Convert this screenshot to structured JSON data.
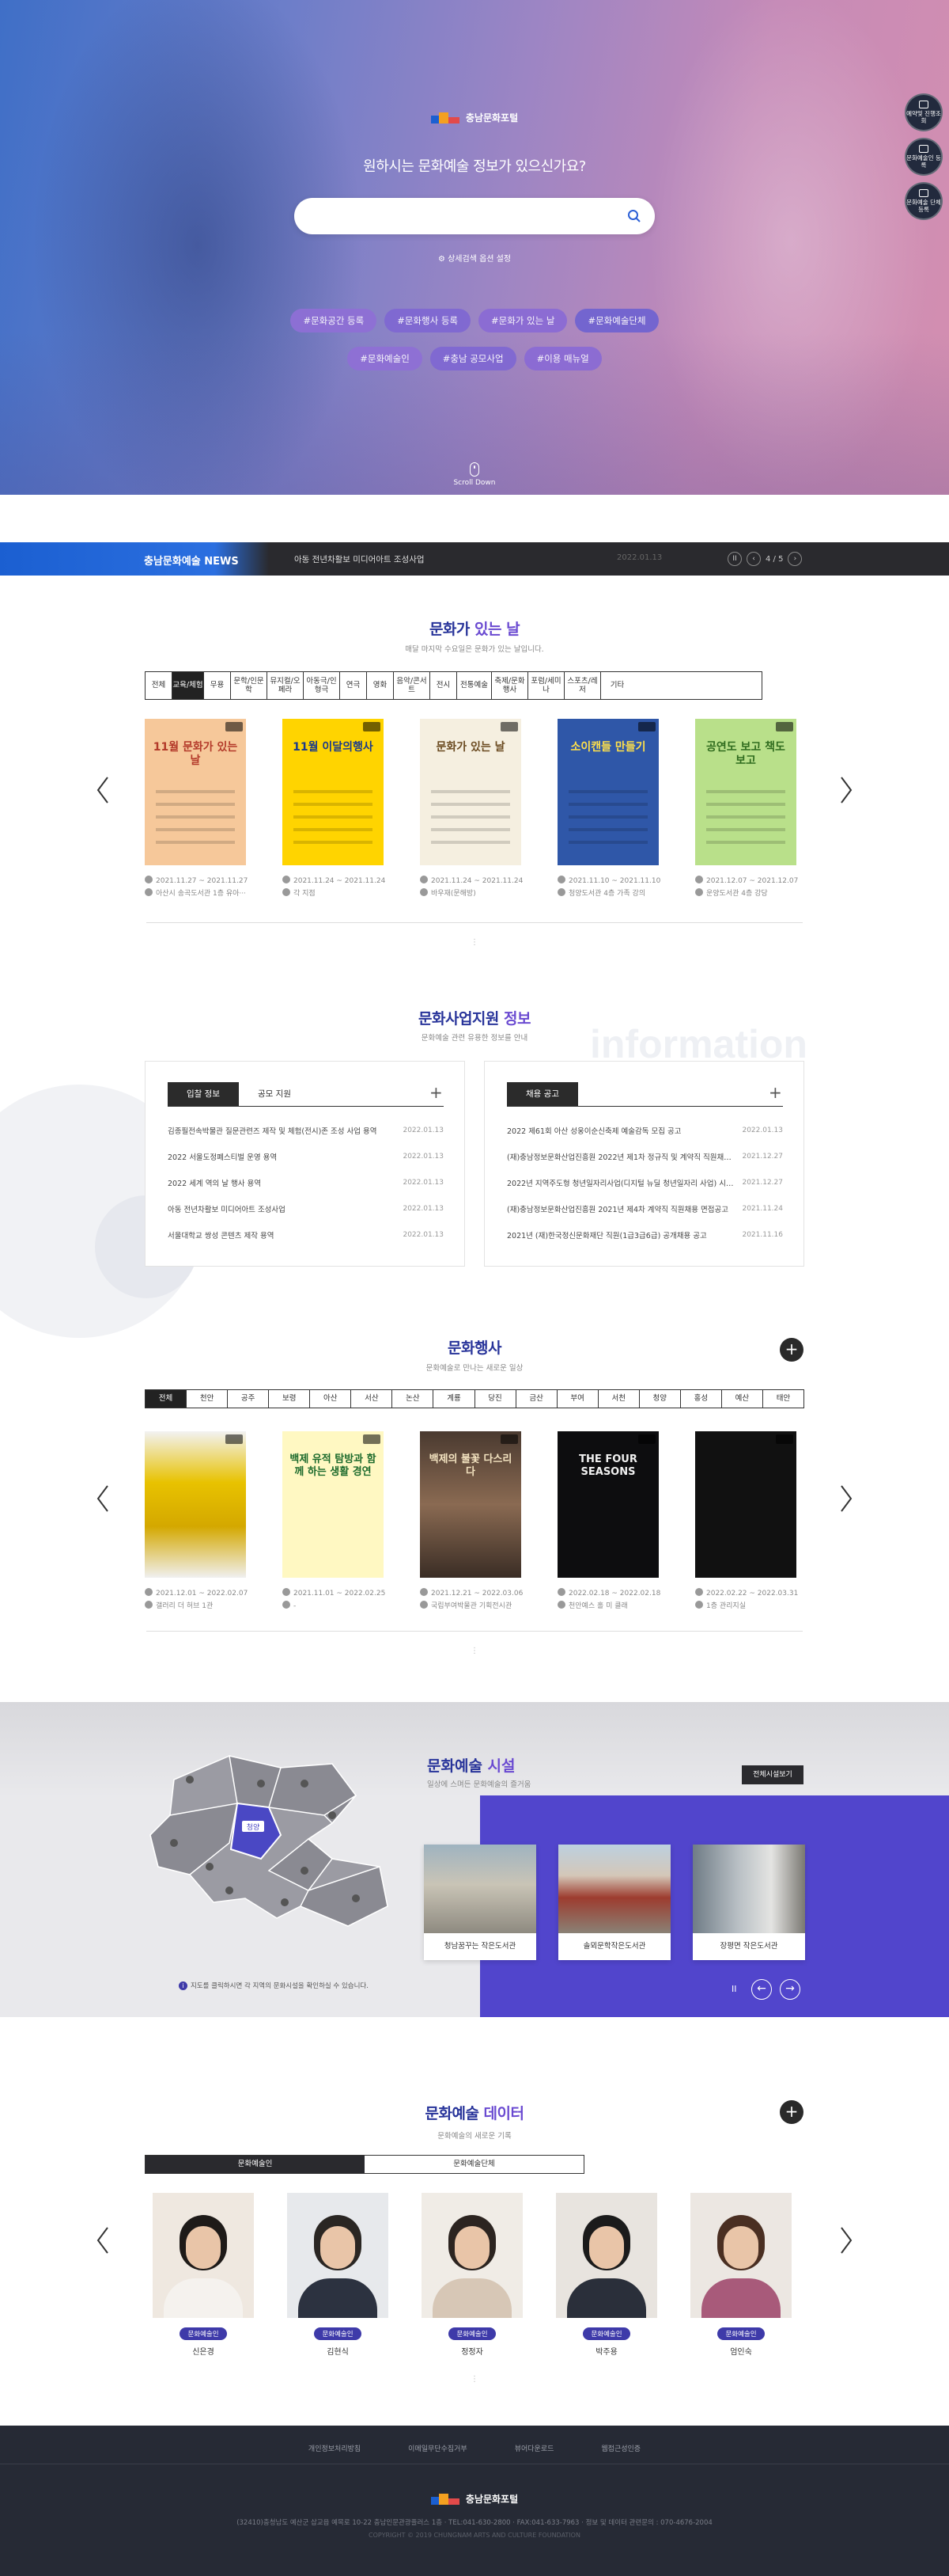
{
  "hero": {
    "logo_text": "충남문화포털",
    "title": "원하시는 문화예술 정보가 있으신가요?",
    "search_placeholder": "",
    "advanced_link": "상세검색 옵션 설정",
    "tags_row1": [
      "#문화공간 등록",
      "#문화행사 등록",
      "#문화가 있는 날",
      "#문화예술단체"
    ],
    "tags_row2": [
      "#문화예술인",
      "#충남 공모사업",
      "#이용 매뉴얼"
    ],
    "scroll_label": "Scroll Down",
    "quick_menu": [
      "예약및 진행조회",
      "문화예술인 등록",
      "문화예술 단체등록"
    ]
  },
  "news": {
    "label": "충남문화예술 NEWS",
    "headline": "아동 전년차활보 미디어아트 조성사업",
    "date": "2022.01.13",
    "pager": "4 / 5"
  },
  "culture_day": {
    "title_main": "문화가 ",
    "title_accent": "있는 날",
    "subtitle": "매달 마지막 수요일은 문화가 있는 날입니다.",
    "categories": [
      "전체",
      "교육/체험",
      "무용",
      "문학/인문학",
      "뮤지컬/오페라",
      "아동극/인형극",
      "연극",
      "영화",
      "음악/콘서트",
      "전시",
      "전통예술",
      "축제/문화행사",
      "포럼/세미나",
      "스포츠/레저",
      "기타"
    ],
    "active_category": 1,
    "cards": [
      {
        "poster_title": "11월 문화가 있는 날",
        "date": "2021.11.27 ~ 2021.11.27",
        "place": "아산시 송곡도서관 1층 유아···"
      },
      {
        "poster_title": "11월 이달의행사",
        "date": "2021.11.24 ~ 2021.11.24",
        "place": "각 지점"
      },
      {
        "poster_title": "문화가 있는 날",
        "date": "2021.11.24 ~ 2021.11.24",
        "place": "바우재(문해방)"
      },
      {
        "poster_title": "소이캔들 만들기",
        "date": "2021.11.10 ~ 2021.11.10",
        "place": "청양도서관 4층 가족 강의"
      },
      {
        "poster_title": "공연도 보고 책도 보고",
        "date": "2021.12.07 ~ 2021.12.07",
        "place": "운양도서관 4층 강당"
      }
    ]
  },
  "support": {
    "title_main": "문화사업지원 ",
    "title_accent": "정보",
    "subtitle": "문화예술 관련 유용한 정보를 안내",
    "watermark": "information",
    "left_tabs": [
      "입찰 정보",
      "공모 지원"
    ],
    "left_items": [
      {
        "title": "김종필전속박물관 질문관련즈 제작 및 체험(전시)존 조성 사업 용역",
        "date": "2022.01.13"
      },
      {
        "title": "2022 서울도정폐스티벌 운영 용역",
        "date": "2022.01.13"
      },
      {
        "title": "2022 세계 역의 날 행사 용역",
        "date": "2022.01.13"
      },
      {
        "title": "아동 전년차활보 미디어아트 조성사업",
        "date": "2022.01.13"
      },
      {
        "title": "서울대학교 쌍성 콘텐츠 제작 용역",
        "date": "2022.01.13"
      }
    ],
    "right_tab": "채용 공고",
    "right_items": [
      {
        "title": "2022 제61회 아산 성웅이순신축제 예술감독 모집 공고",
        "date": "2022.01.13"
      },
      {
        "title": "(재)충남정보문화산업진흥원 2022년 제1차 정규직 및 계약직 직원채용 ···",
        "date": "2021.12.27"
      },
      {
        "title": "2022년 지역주도형 청년일자리사업(디지털 뉴딜 청년일자리 사업) 시행···",
        "date": "2021.12.27"
      },
      {
        "title": "(재)충남정보문화산업진흥원 2021년 제4차 계약직 직원채용 면접공고",
        "date": "2021.11.24"
      },
      {
        "title": "2021년 (재)한국정신문화재단 직원(1급3급6급) 공개채용 공고",
        "date": "2021.11.16"
      }
    ]
  },
  "events": {
    "title": "문화행사",
    "subtitle": "문화예술로 만나는 새로운 일상",
    "regions": [
      "전체",
      "천안",
      "공주",
      "보령",
      "아산",
      "서산",
      "논산",
      "계룡",
      "당진",
      "금산",
      "부여",
      "서천",
      "청양",
      "홍성",
      "예산",
      "태안"
    ],
    "active_region": 0,
    "cards": [
      {
        "poster_title": "",
        "date": "2021.12.01 ~ 2022.02.07",
        "place": "갤러리 더 허브 1관"
      },
      {
        "poster_title": "백제 유적 탐방과 함께 하는 생활 경연",
        "date": "2021.11.01 ~ 2022.02.25",
        "place": "-"
      },
      {
        "poster_title": "백제의 불꽃 다스리다",
        "date": "2021.12.21 ~ 2022.03.06",
        "place": "국립부여박물관 기획전시관"
      },
      {
        "poster_title": "THE FOUR SEASONS",
        "date": "2022.02.18 ~ 2022.02.18",
        "place": "천안예스 홀 미 클래"
      },
      {
        "poster_title": "",
        "date": "2022.02.22 ~ 2022.03.31",
        "place": "1층 관리지실"
      }
    ]
  },
  "facility": {
    "title_main": "문화예술 ",
    "title_accent": "시설",
    "subtitle": "일상에 스며든 문화예술의 즐거움",
    "view_all": "전체시설보기",
    "map_label": "청양",
    "map_notice": "지도를 클릭하시면 각 지역의 문화시설을 확인하실 수 있습니다.",
    "cards": [
      "청남꿈꾸는 작은도서관",
      "솔뫼문학작은도서관",
      "장평면 작은도서관"
    ]
  },
  "data_section": {
    "title_main": "문화예술 ",
    "title_accent": "데이터",
    "subtitle": "문화예술의 새로운 기록",
    "tabs": [
      "문화예술인",
      "문화예술단체"
    ],
    "people": [
      {
        "tag": "문화예술인",
        "name": "신은경"
      },
      {
        "tag": "문화예술인",
        "name": "김현식"
      },
      {
        "tag": "문화예술인",
        "name": "정정자"
      },
      {
        "tag": "문화예술인",
        "name": "박주용"
      },
      {
        "tag": "문화예술인",
        "name": "엄인숙"
      }
    ]
  },
  "footer": {
    "links": [
      "개인정보처리방침",
      "이메일무단수집거부",
      "뷰어다운로드",
      "웹접근성인증"
    ],
    "logo_text": "충남문화포털",
    "address": "(32410)충청남도 예산군 삽교읍 예목로 10-22 충남인문관광플러스 1층 · TEL:041-630-2800 · FAX:041-633-7963 · 정보 및 데이터 관련문의 : 070-4676-2004",
    "copyright": "COPYRIGHT © 2019 CHUNGNAM ARTS AND CULTURE FOUNDATION"
  },
  "colors": {
    "primary": "#28349a",
    "accent": "#6a4ad1",
    "news_blue": "#1b5fd1",
    "facility_purple": "#5145cc",
    "footer": "#262a35"
  }
}
